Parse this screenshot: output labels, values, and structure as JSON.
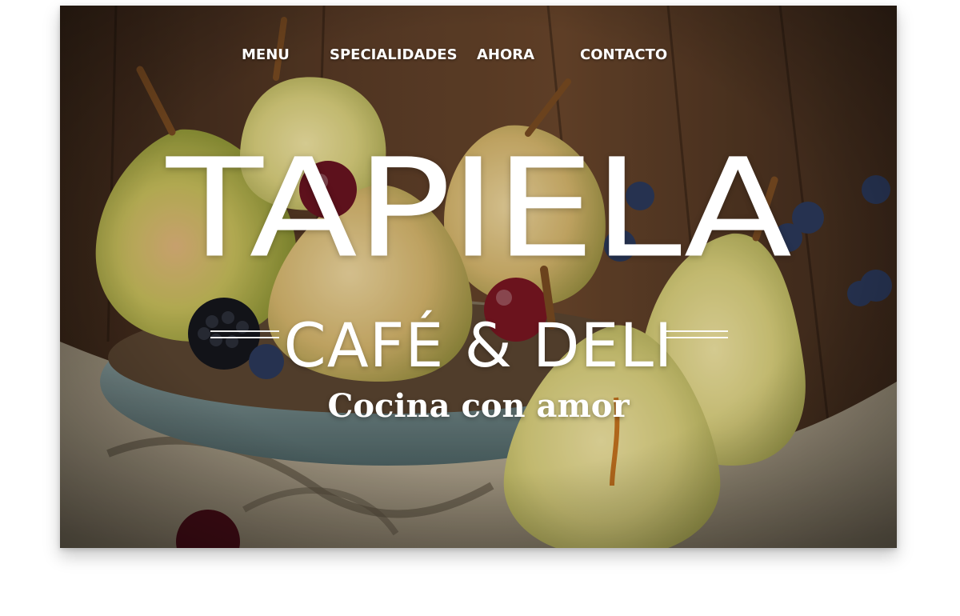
{
  "nav": {
    "items": [
      {
        "label": "MENU"
      },
      {
        "label": "SPECIALIDADES"
      },
      {
        "label": "AHORA"
      },
      {
        "label": "CONTACTO"
      }
    ]
  },
  "brand": {
    "title": "TAPIELA",
    "subtitle": "CAFÉ & DELI",
    "tagline": "Cocina con amor"
  },
  "hero": {
    "image": "pears-in-bowl-photo"
  },
  "colors": {
    "text": "#ffffff",
    "wood": "#4a3222",
    "pear": "#c7c25a",
    "bowl": "#6f8a8a",
    "burlap": "#b8ab93",
    "berry": "#2c3a5c"
  }
}
